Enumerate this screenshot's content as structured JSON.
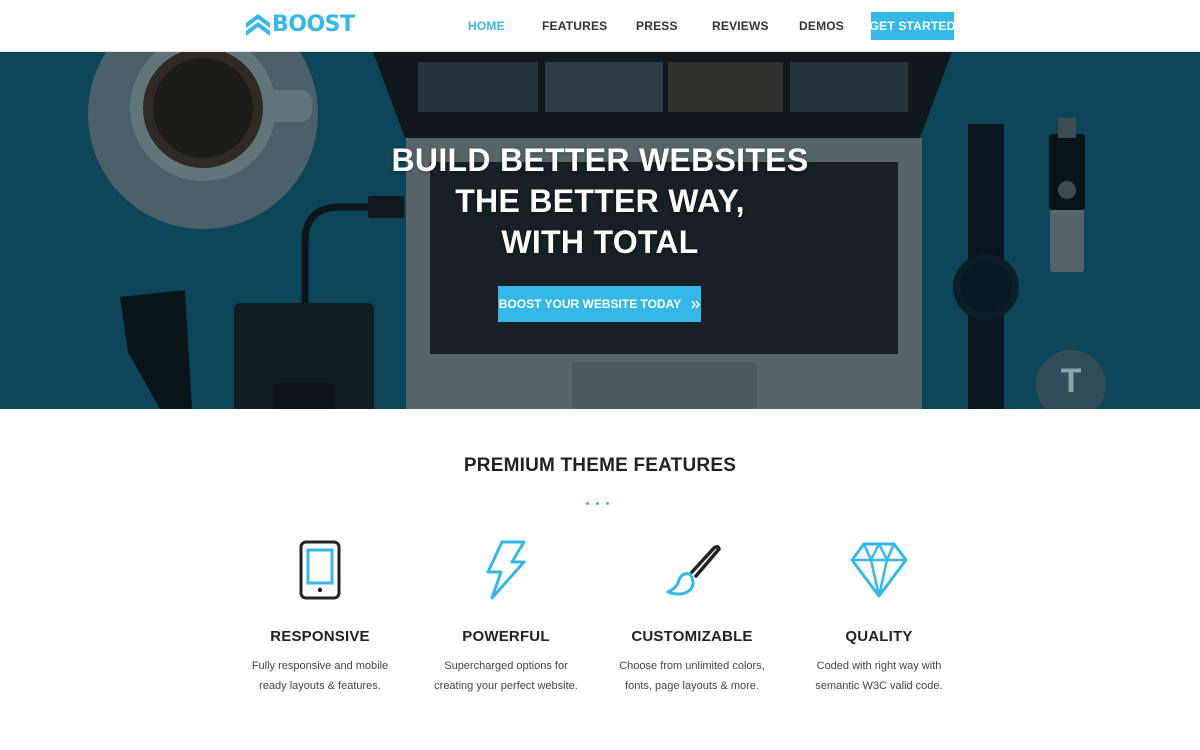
{
  "header": {
    "logo_text": "BOOST",
    "nav": [
      {
        "label": "HOME",
        "active": true
      },
      {
        "label": "FEATURES",
        "active": false
      },
      {
        "label": "PRESS",
        "active": false
      },
      {
        "label": "REVIEWS",
        "active": false
      },
      {
        "label": "DEMOS",
        "active": false
      }
    ],
    "cta_label": "GET STARTED"
  },
  "hero": {
    "title_lines": [
      "BUILD BETTER WEBSITES",
      "THE BETTER WAY,",
      "WITH TOTAL"
    ],
    "cta_label": "BOOST YOUR WEBSITE TODAY",
    "cta_icon": "double-chevron-right-icon",
    "badge_letter": "T"
  },
  "features": {
    "title": "PREMIUM THEME FEATURES",
    "items": [
      {
        "icon": "tablet-icon",
        "title": "RESPONSIVE",
        "desc_lines": [
          "Fully responsive and mobile",
          "ready layouts & features."
        ]
      },
      {
        "icon": "lightning-icon",
        "title": "POWERFUL",
        "desc_lines": [
          "Supercharged options for",
          "creating your perfect website."
        ]
      },
      {
        "icon": "paintbrush-icon",
        "title": "CUSTOMIZABLE",
        "desc_lines": [
          "Choose from unlimited colors,",
          "fonts, page layouts & more."
        ]
      },
      {
        "icon": "diamond-icon",
        "title": "QUALITY",
        "desc_lines": [
          "Coded with right way with",
          "semantic W3C valid code."
        ]
      }
    ]
  },
  "colors": {
    "accent": "#35b7e8",
    "hero_bg": "#0f4c63",
    "text_dark": "#222222"
  }
}
